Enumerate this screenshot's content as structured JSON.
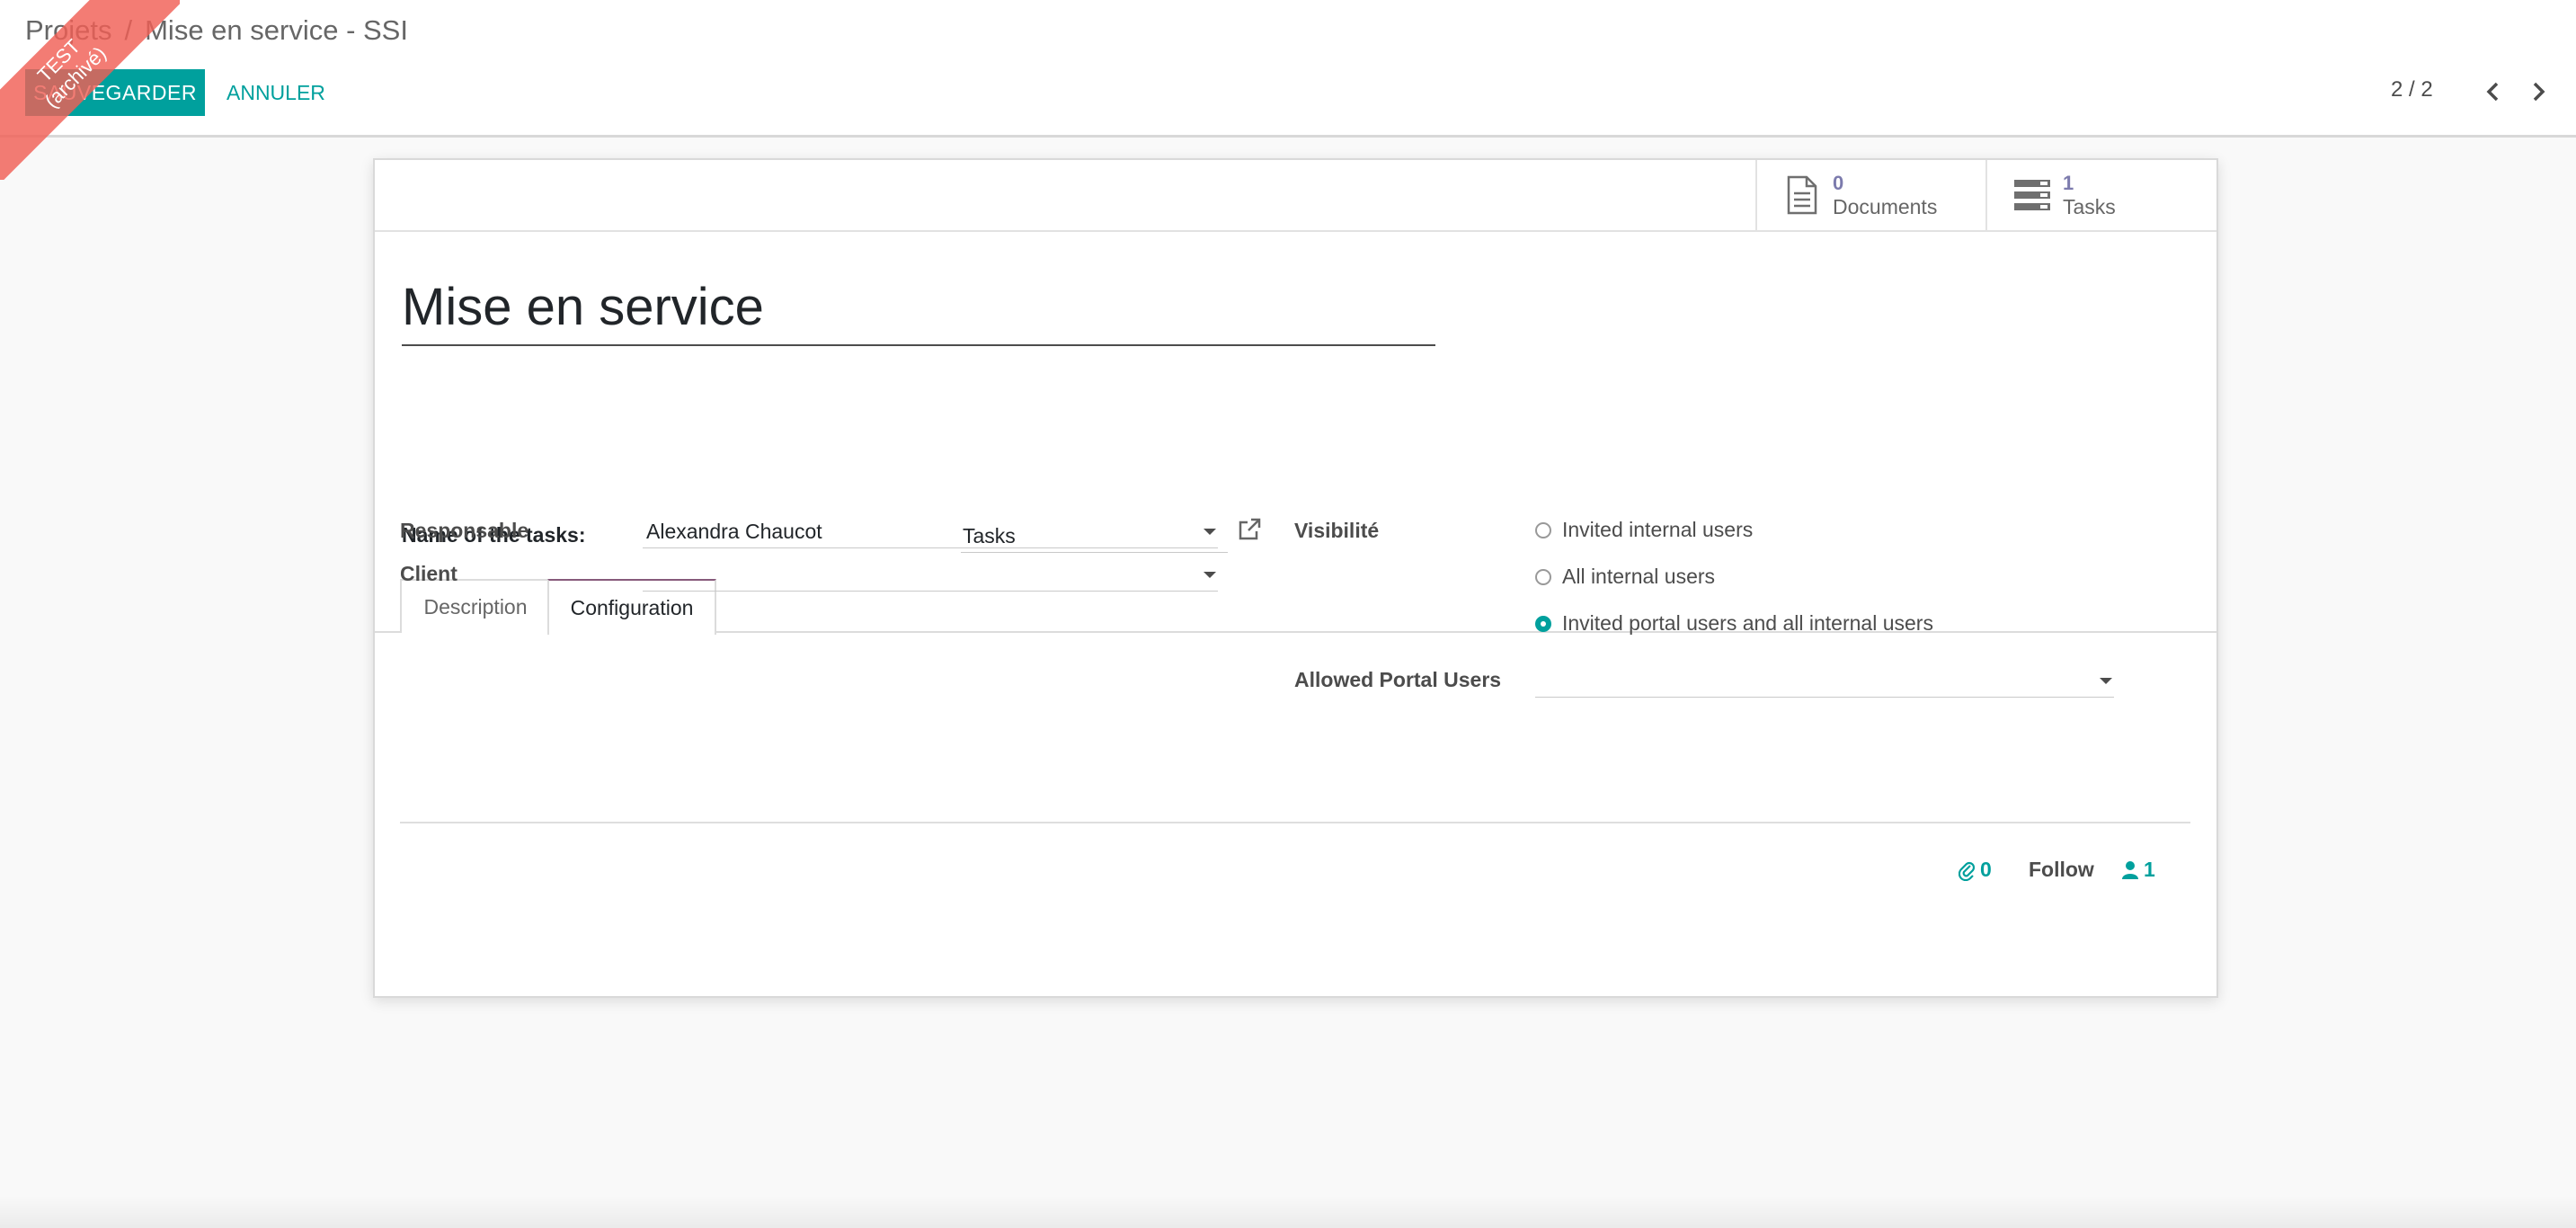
{
  "breadcrumb": {
    "parent": "Projets",
    "separator": "/",
    "current": "Mise en service - SSI"
  },
  "toolbar": {
    "save_label": "SAUVEGARDER",
    "cancel_label": "ANNULER"
  },
  "pager": {
    "value": "2 / 2"
  },
  "ribbon": {
    "line1": "TEST",
    "line2": "(archivé)"
  },
  "stat_buttons": [
    {
      "count": "0",
      "label": "Documents",
      "icon": "document-icon"
    },
    {
      "count": "1",
      "label": "Tasks",
      "icon": "tasks-icon"
    }
  ],
  "form": {
    "title": "Mise en service",
    "task_name_label": "Name of the tasks:",
    "task_name_value": "Tasks"
  },
  "tabs": [
    {
      "label": "Description",
      "active": false
    },
    {
      "label": "Configuration",
      "active": true
    }
  ],
  "config": {
    "responsable_label": "Responsable",
    "responsable_value": "Alexandra Chaucot",
    "client_label": "Client",
    "client_value": "",
    "visibility_label": "Visibilité",
    "visibility_options": [
      {
        "label": "Invited internal users",
        "checked": false
      },
      {
        "label": "All internal users",
        "checked": false
      },
      {
        "label": "Invited portal users and all internal users",
        "checked": true
      }
    ],
    "portal_users_label": "Allowed Portal Users",
    "portal_users_value": ""
  },
  "chatter": {
    "attachments_count": "0",
    "follow_label": "Follow",
    "followers_count": "1"
  },
  "colors": {
    "primary": "#00A09D",
    "brand": "#875A7B",
    "stat_count": "#7C7BAD",
    "ribbon": "#F05F55"
  }
}
